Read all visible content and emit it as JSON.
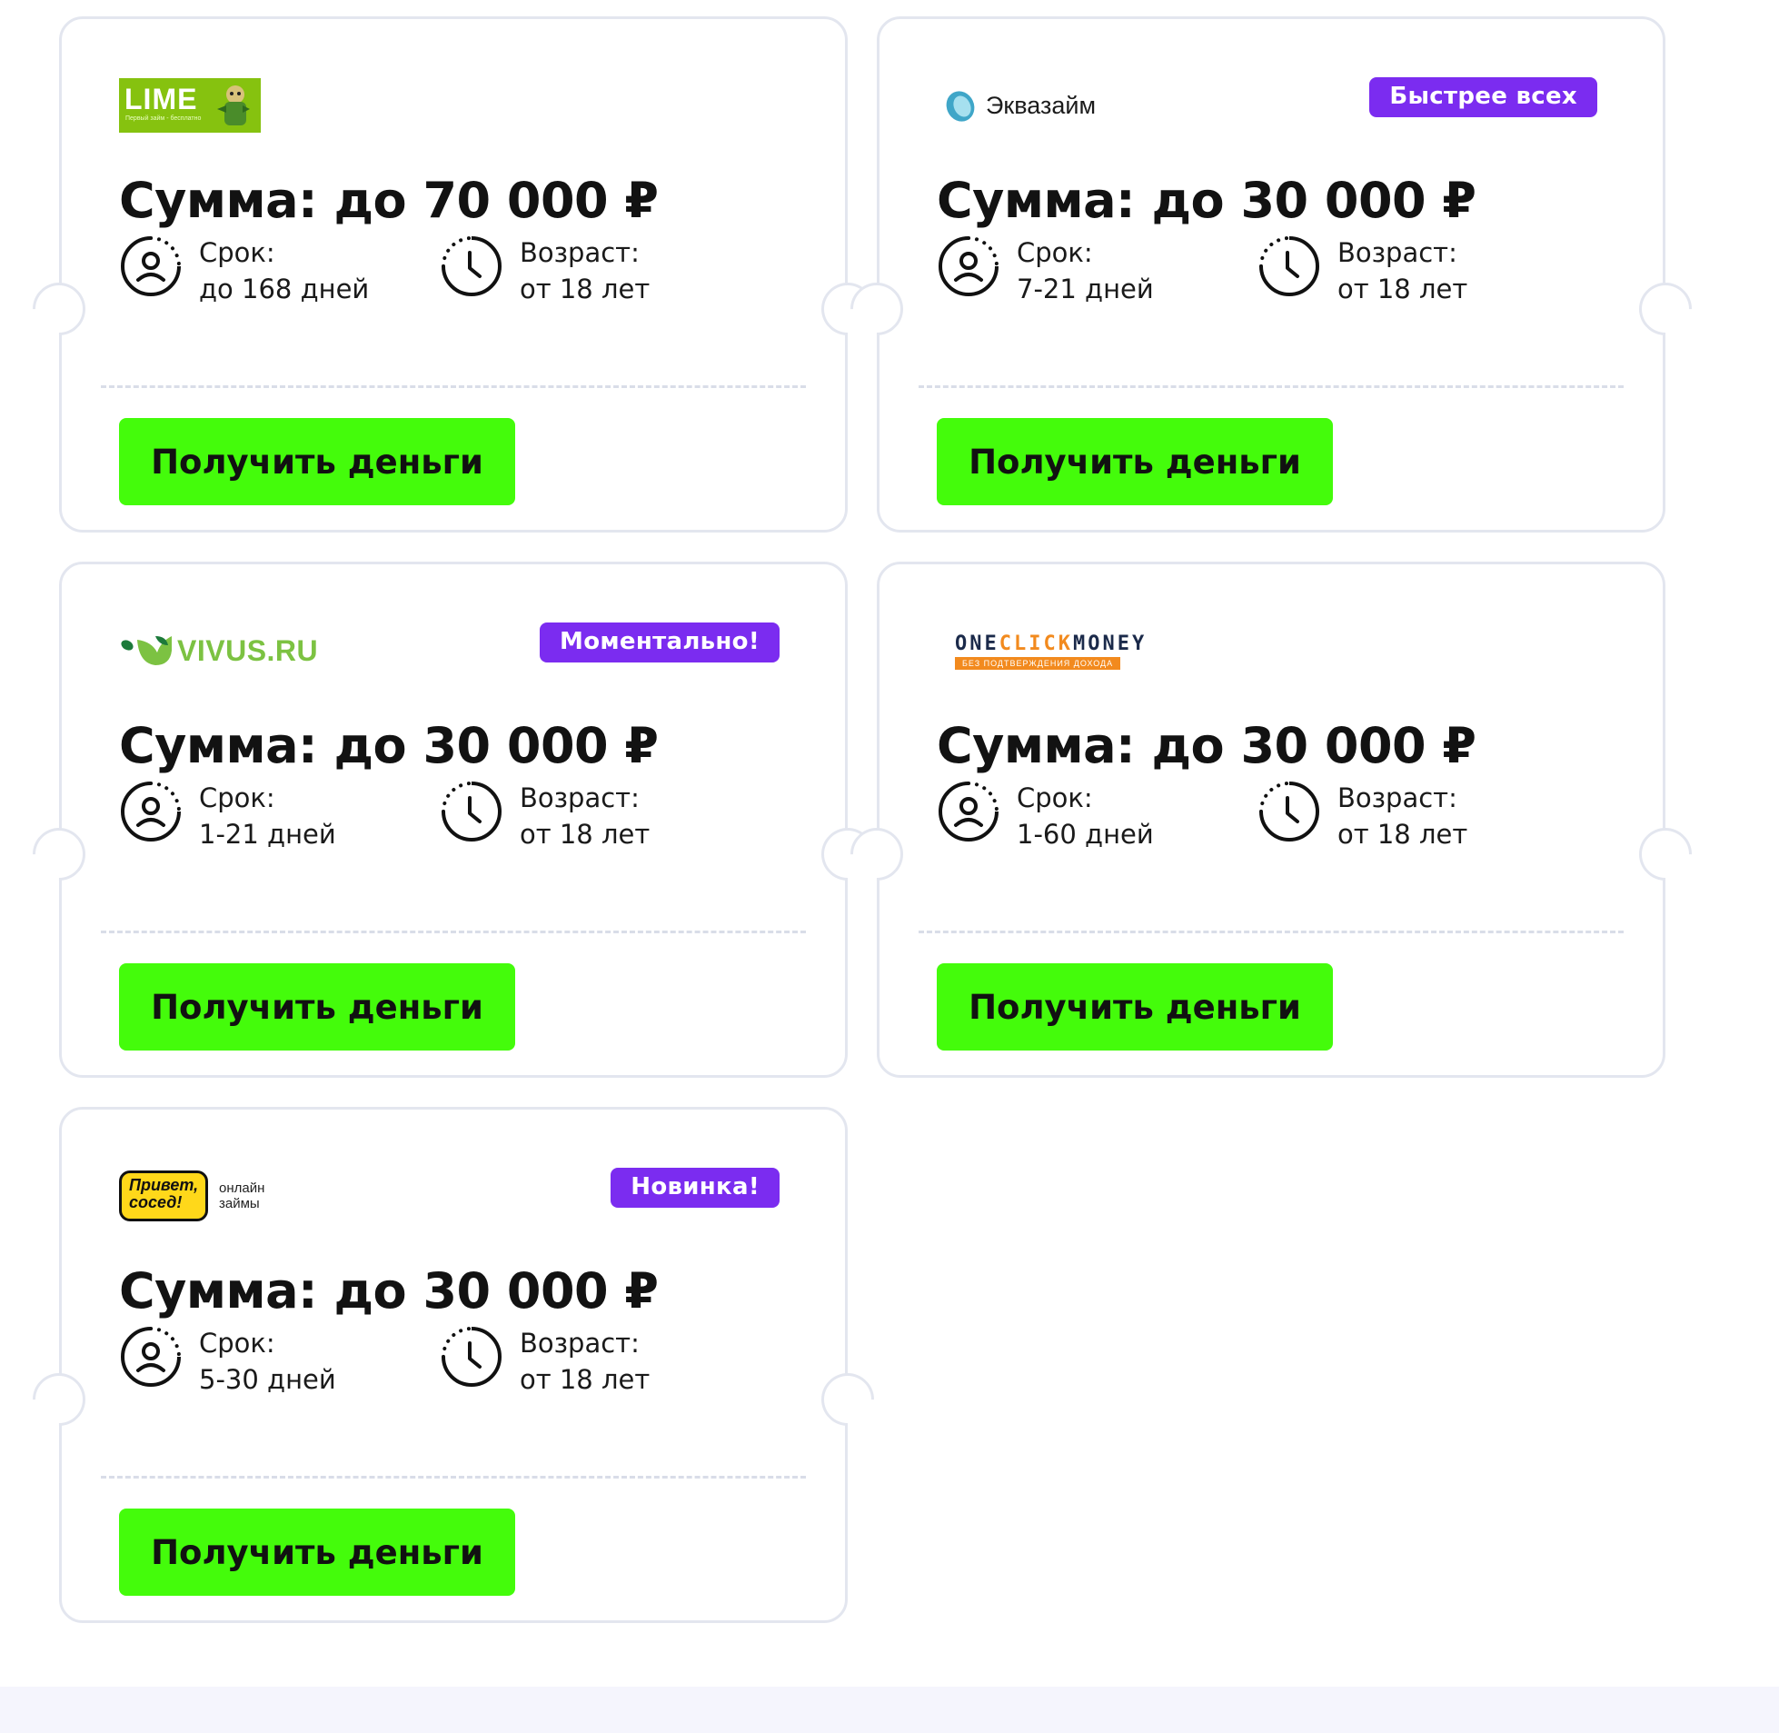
{
  "cta_label": "Получить деньги",
  "colors": {
    "accent_green": "#44fc0b",
    "badge_purple": "#7b2cf0",
    "card_border": "#e3e6ef"
  },
  "cards": [
    {
      "lender": "lime",
      "logo": {
        "text": "LIME",
        "tagline": "Первый займ - бесплатно"
      },
      "badge": "",
      "amount": "Сумма: до 70 000 ₽",
      "term_label": "Срок:",
      "term_value": "до 168 дней",
      "age_label": "Возраст:",
      "age_value": "от 18 лет"
    },
    {
      "lender": "ekvazaim",
      "logo": {
        "text": "Эквазайм"
      },
      "badge": "Быстрее всех",
      "amount": "Сумма: до 30 000 ₽",
      "term_label": "Срок:",
      "term_value": "7-21 дней",
      "age_label": "Возраст:",
      "age_value": "от 18 лет"
    },
    {
      "lender": "vivus",
      "logo": {
        "text": "VIVUS.RU"
      },
      "badge": "Моментально!",
      "amount": "Сумма: до 30 000 ₽",
      "term_label": "Срок:",
      "term_value": "1-21 дней",
      "age_label": "Возраст:",
      "age_value": "от 18 лет"
    },
    {
      "lender": "oneclickmoney",
      "logo": {
        "text_a": "ONE",
        "text_b": "CLICK",
        "text_c": "MONEY",
        "tagline": "БЕЗ ПОДТВЕРЖДЕНИЯ ДОХОДА"
      },
      "badge": "",
      "amount": "Сумма: до 30 000 ₽",
      "term_label": "Срок:",
      "term_value": "1-60 дней",
      "age_label": "Возраст:",
      "age_value": "от 18 лет"
    },
    {
      "lender": "privet-sosed",
      "logo": {
        "line1": "Привет,",
        "line2": "сосед!",
        "cap1": "онлайн",
        "cap2": "займы"
      },
      "badge": "Новинка!",
      "amount": "Сумма: до 30 000 ₽",
      "term_label": "Срок:",
      "term_value": "5-30 дней",
      "age_label": "Возраст:",
      "age_value": "от 18 лет"
    }
  ]
}
